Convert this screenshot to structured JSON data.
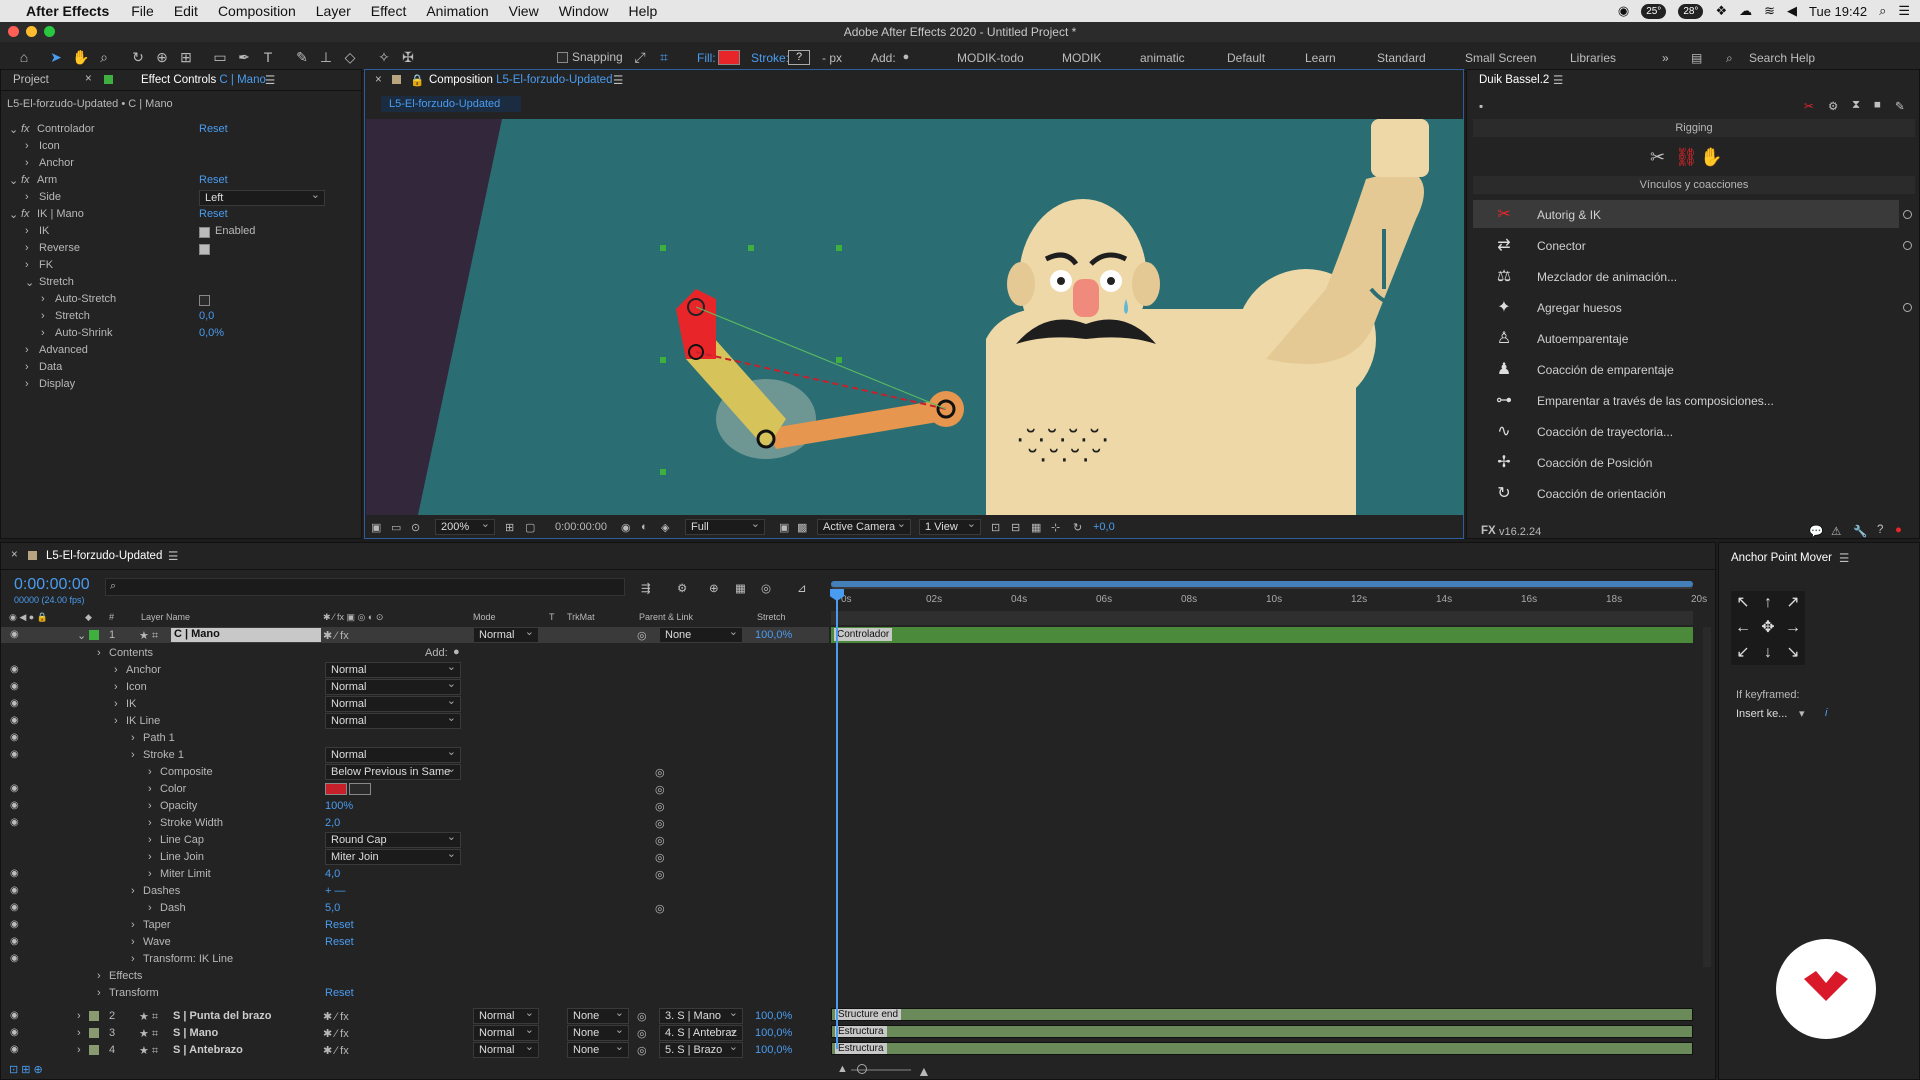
{
  "menubar": {
    "app_name": "After Effects",
    "items": [
      "File",
      "Edit",
      "Composition",
      "Layer",
      "Effect",
      "Animation",
      "View",
      "Window",
      "Help"
    ],
    "temp1": "25°",
    "temp2": "28°",
    "clock": "Tue 19:42"
  },
  "titlebar": {
    "title": "Adobe After Effects 2020 - Untitled Project *"
  },
  "toolbar": {
    "snapping": "Snapping",
    "fill": "Fill:",
    "stroke": "Stroke:",
    "stroke_unit": "- px",
    "add": "Add:",
    "workspaces": [
      "MODIK-todo",
      "MODIK",
      "animatic",
      "Default",
      "Learn",
      "Standard",
      "Small Screen",
      "Libraries"
    ],
    "search_placeholder": "Search Help",
    "fill_color": "#e8262a"
  },
  "effect_controls": {
    "tab_project": "Project",
    "tab_label": "Effect Controls",
    "tab_target": "C | Mano",
    "path": "L5-El-forzudo-Updated • C | Mano",
    "rows": [
      {
        "label": "Controlador",
        "value": "Reset",
        "indent": 0,
        "fx": true
      },
      {
        "label": "Icon",
        "value": "",
        "indent": 1
      },
      {
        "label": "Anchor",
        "value": "",
        "indent": 1
      },
      {
        "label": "Arm",
        "value": "Reset",
        "indent": 0,
        "fx": true
      },
      {
        "label": "Side",
        "value": "Left",
        "indent": 1
      },
      {
        "label": "IK | Mano",
        "value": "Reset",
        "indent": 0,
        "fx": true
      },
      {
        "label": "IK",
        "value": "Enabled",
        "indent": 1
      },
      {
        "label": "Reverse",
        "value": "",
        "indent": 1
      },
      {
        "label": "FK",
        "value": "",
        "indent": 1
      },
      {
        "label": "Stretch",
        "value": "",
        "indent": 1
      },
      {
        "label": "Auto-Stretch",
        "value": "",
        "indent": 2
      },
      {
        "label": "Stretch",
        "value": "0,0",
        "indent": 2
      },
      {
        "label": "Auto-Shrink",
        "value": "0,0%",
        "indent": 2
      },
      {
        "label": "Advanced",
        "value": "",
        "indent": 1
      },
      {
        "label": "Data",
        "value": "",
        "indent": 1
      },
      {
        "label": "Display",
        "value": "",
        "indent": 1
      }
    ]
  },
  "composition": {
    "tab_label": "Composition",
    "tab_name": "L5-El-forzudo-Updated",
    "sub_tab": "L5-El-forzudo-Updated",
    "zoom": "200%",
    "timecode": "0:00:00:00",
    "resolution": "Full",
    "camera": "Active Camera",
    "views": "1 View",
    "exposure": "+0,0",
    "colors": {
      "bg": "#2a6e74",
      "skin": "#eed8a8",
      "hand": "#e8262a",
      "arm": "#e6964e"
    }
  },
  "duik": {
    "title": "Duik Bassel.2",
    "section": "Rigging",
    "subsection": "Vínculos y coacciones",
    "items": [
      "Autorig & IK",
      "Conector",
      "Mezclador de animación...",
      "Agregar huesos",
      "Autoemparentaje",
      "Coacción de emparentaje",
      "Emparentar a través de las composiciones...",
      "Coacción de trayectoria...",
      "Coacción de Posición",
      "Coacción de orientación"
    ],
    "version": "v16.2.24"
  },
  "timeline": {
    "tab_name": "L5-El-forzudo-Updated",
    "timecode": "0:00:00:00",
    "frames": "00000 (24.00 fps)",
    "headers": {
      "name": "Layer Name",
      "mode": "Mode",
      "t": "T",
      "trkmat": "TrkMat",
      "parent": "Parent & Link",
      "stretch": "Stretch"
    },
    "ruler": [
      "0s",
      "02s",
      "04s",
      "06s",
      "08s",
      "10s",
      "12s",
      "14s",
      "16s",
      "18s",
      "20s"
    ],
    "layer1": {
      "num": "1",
      "name": "C | Mano",
      "mode": "Normal",
      "parent": "None",
      "stretch": "100,0%",
      "bar": "Controlador"
    },
    "props": [
      {
        "label": "Contents",
        "indent": 0,
        "value": "",
        "extra": "Add:"
      },
      {
        "label": "Anchor",
        "indent": 1,
        "value": "Normal"
      },
      {
        "label": "Icon",
        "indent": 1,
        "value": "Normal"
      },
      {
        "label": "IK",
        "indent": 1,
        "value": "Normal"
      },
      {
        "label": "IK Line",
        "indent": 1,
        "value": "Normal"
      },
      {
        "label": "Path 1",
        "indent": 2,
        "value": ""
      },
      {
        "label": "Stroke 1",
        "indent": 2,
        "value": "Normal"
      },
      {
        "label": "Composite",
        "indent": 3,
        "value": "Below Previous in Same"
      },
      {
        "label": "Color",
        "indent": 3,
        "value": ""
      },
      {
        "label": "Opacity",
        "indent": 3,
        "value": "100%"
      },
      {
        "label": "Stroke Width",
        "indent": 3,
        "value": "2,0"
      },
      {
        "label": "Line Cap",
        "indent": 3,
        "value": "Round Cap"
      },
      {
        "label": "Line Join",
        "indent": 3,
        "value": "Miter Join"
      },
      {
        "label": "Miter Limit",
        "indent": 3,
        "value": "4,0"
      },
      {
        "label": "Dashes",
        "indent": 2,
        "value": "+ —"
      },
      {
        "label": "Dash",
        "indent": 3,
        "value": "5,0"
      },
      {
        "label": "Taper",
        "indent": 2,
        "value": "Reset"
      },
      {
        "label": "Wave",
        "indent": 2,
        "value": "Reset"
      },
      {
        "label": "Transform: IK Line",
        "indent": 2,
        "value": ""
      },
      {
        "label": "Effects",
        "indent": 0,
        "value": ""
      },
      {
        "label": "Transform",
        "indent": 0,
        "value": "Reset"
      }
    ],
    "layers": [
      {
        "num": "2",
        "name": "S | Punta del brazo",
        "mode": "Normal",
        "trkmat": "None",
        "parent": "3. S | Mano",
        "stretch": "100,0%",
        "bar": "Structure end"
      },
      {
        "num": "3",
        "name": "S | Mano",
        "mode": "Normal",
        "trkmat": "None",
        "parent": "4. S | Antebraz",
        "stretch": "100,0%",
        "bar": "Estructura"
      },
      {
        "num": "4",
        "name": "S | Antebrazo",
        "mode": "Normal",
        "trkmat": "None",
        "parent": "5. S | Brazo",
        "stretch": "100,0%",
        "bar": "Estructura"
      }
    ]
  },
  "anchor_mover": {
    "title": "Anchor Point Mover",
    "if_keyframed": "If keyframed:",
    "insert": "Insert ke..."
  }
}
